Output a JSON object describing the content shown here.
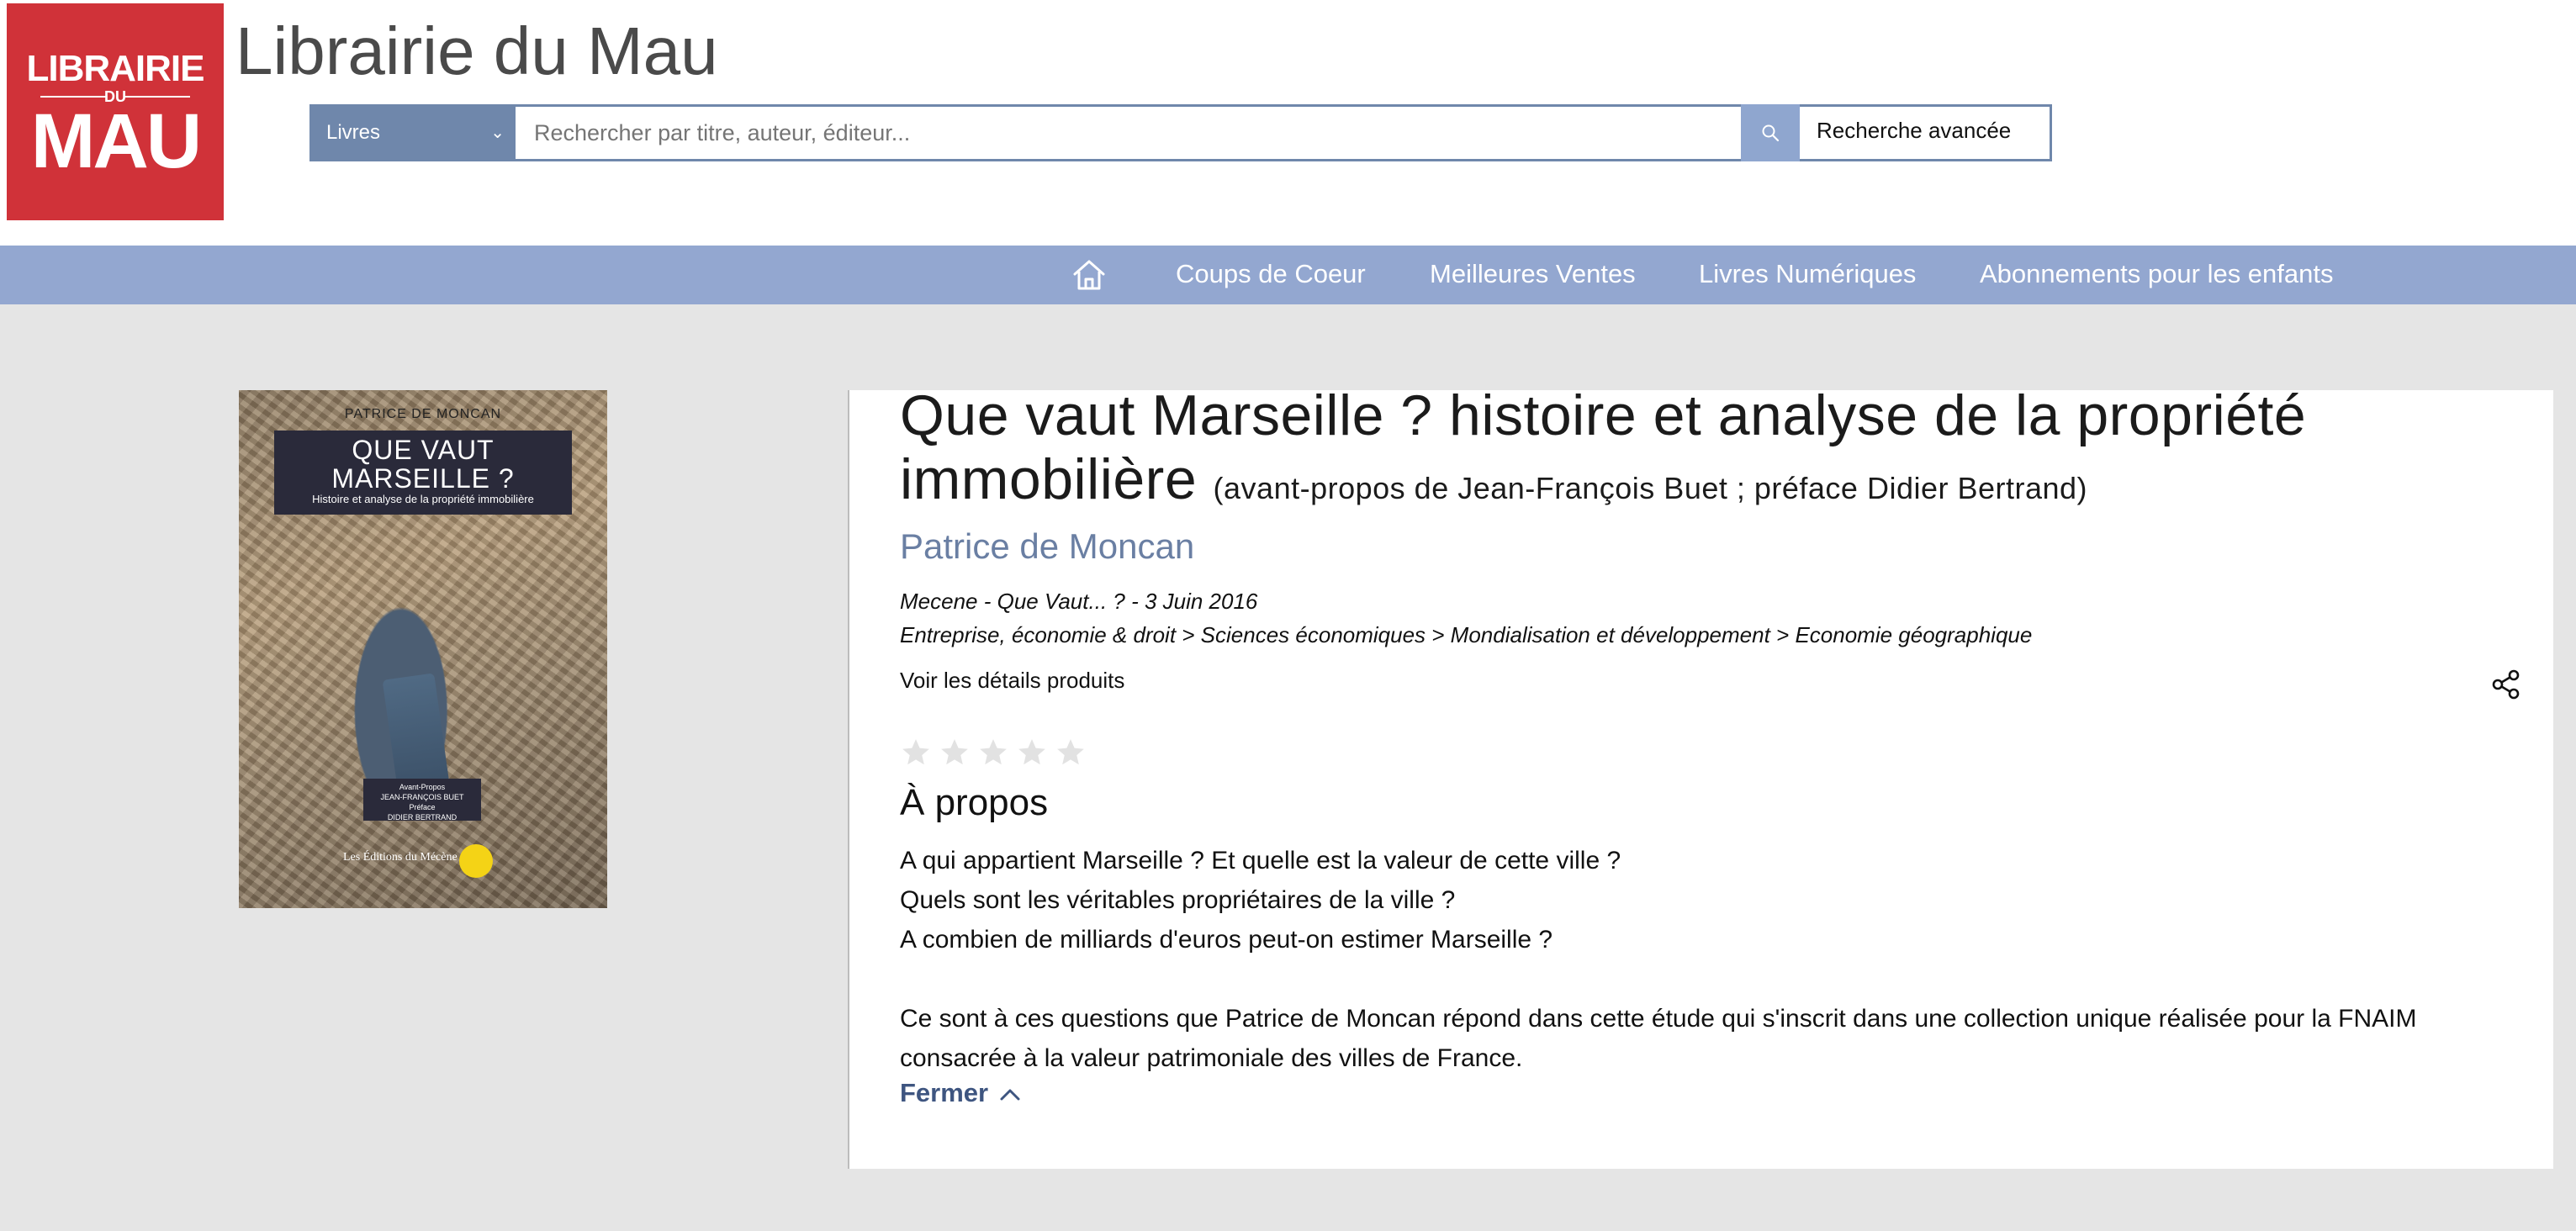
{
  "site": {
    "logo": {
      "line1": "LIBRAIRIE",
      "line2": "DU",
      "line3": "MAU"
    },
    "title": "Librairie du Mau"
  },
  "search": {
    "category": "Livres",
    "placeholder": "Rechercher par titre, auteur, éditeur...",
    "advanced_label": "Recherche avancée"
  },
  "nav": {
    "items": [
      {
        "label": "Coups de Coeur"
      },
      {
        "label": "Meilleures Ventes"
      },
      {
        "label": "Livres Numériques"
      },
      {
        "label": "Abonnements pour les enfants"
      }
    ]
  },
  "cover": {
    "author": "PATRICE DE MONCAN",
    "title_line1": "QUE VAUT",
    "title_line2": "MARSEILLE ?",
    "subtitle": "Histoire et analyse de la propriété immobilière",
    "credit_line1": "Avant-Propos",
    "credit_line2": "JEAN-FRANÇOIS BUET",
    "credit_line3": "Préface",
    "credit_line4": "DIDIER BERTRAND",
    "publisher": "Les Éditions du Mécène"
  },
  "product": {
    "title": "Que vaut Marseille ? histoire et analyse de la propriété immobilière",
    "subtitle": "(avant-propos de Jean-François Buet ; préface Didier Bertrand)",
    "author": "Patrice de Moncan",
    "meta": "Mecene - Que Vaut... ? - 3 Juin 2016",
    "categories": "Entreprise, économie & droit > Sciences économiques > Mondialisation et développement > Economie géographique",
    "details_label": "Voir les détails produits",
    "rating": 0,
    "about_heading": "À propos",
    "about": [
      "A qui appartient Marseille ? Et quelle est la valeur de cette ville ?",
      "Quels sont les véritables propriétaires de la ville ?",
      "A combien de milliards d'euros peut-on estimer Marseille ?",
      "",
      "Ce sont à ces questions que Patrice de Moncan répond dans cette étude qui s'inscrit dans une collection unique réalisée pour la FNAIM consacrée à la valeur patrimoniale des villes de France."
    ],
    "close_label": "Fermer"
  },
  "colors": {
    "logo_red": "#d03239",
    "nav_blue": "#93a7d0",
    "select_blue": "#6f87ab",
    "author_blue": "#6a7fa3",
    "link_blue": "#3e5580"
  }
}
